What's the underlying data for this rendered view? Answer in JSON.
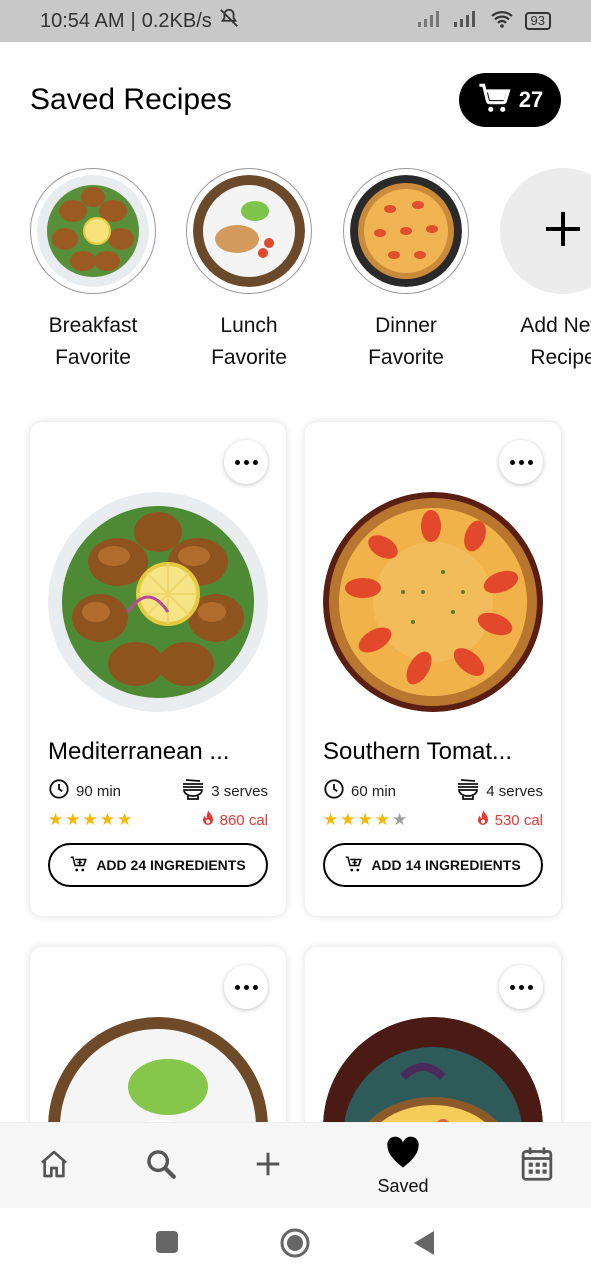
{
  "status_bar": {
    "time": "10:54 AM",
    "speed": "0.2KB/s",
    "battery": "93"
  },
  "header": {
    "title": "Saved Recipes",
    "cart_count": "27"
  },
  "collections": [
    {
      "line1": "Breakfast",
      "line2": "Favorite"
    },
    {
      "line1": "Lunch",
      "line2": "Favorite"
    },
    {
      "line1": "Dinner",
      "line2": "Favorite"
    },
    {
      "line1": "Add New",
      "line2": "Recipe"
    }
  ],
  "recipes": [
    {
      "title": "Mediterranean ...",
      "time": "90 min",
      "serves": "3 serves",
      "rating": 5,
      "calories": "860 cal",
      "button": "ADD 24 INGREDIENTS"
    },
    {
      "title": "Southern Tomat...",
      "time": "60 min",
      "serves": "4 serves",
      "rating": 4,
      "calories": "530 cal",
      "button": "ADD 14 INGREDIENTS"
    }
  ],
  "nav": {
    "saved_label": "Saved"
  },
  "colors": {
    "accent": "#000000",
    "star": "#f5b800",
    "star_empty": "#9e9e9e",
    "calorie": "#e53935"
  }
}
